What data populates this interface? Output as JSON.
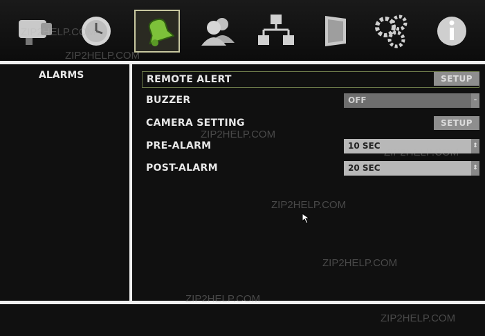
{
  "colors": {
    "background": "#101010",
    "selected_border": "#c8c8a0",
    "active_row_border": "#6c7a4a",
    "button": "#8e8e8e"
  },
  "toolbar": {
    "icons": [
      {
        "name": "camera-icon",
        "selected": false
      },
      {
        "name": "clock-icon",
        "selected": false
      },
      {
        "name": "alarm-bell-icon",
        "selected": true
      },
      {
        "name": "users-icon",
        "selected": false
      },
      {
        "name": "network-icon",
        "selected": false
      },
      {
        "name": "monitor-icon",
        "selected": false
      },
      {
        "name": "settings-gears-icon",
        "selected": false
      },
      {
        "name": "info-icon",
        "selected": false
      }
    ]
  },
  "sidebar": {
    "title": "ALARMS"
  },
  "settings": {
    "remote_alert": {
      "label": "REMOTE ALERT",
      "button": "SETUP"
    },
    "buzzer": {
      "label": "BUZZER",
      "value": "OFF"
    },
    "camera_setting": {
      "label": "CAMERA SETTING",
      "button": "SETUP"
    },
    "pre_alarm": {
      "label": "PRE-ALARM",
      "value": "10 SEC"
    },
    "post_alarm": {
      "label": "POST-ALARM",
      "value": "20 SEC"
    }
  },
  "watermark": "ZIP2HELP.COM"
}
